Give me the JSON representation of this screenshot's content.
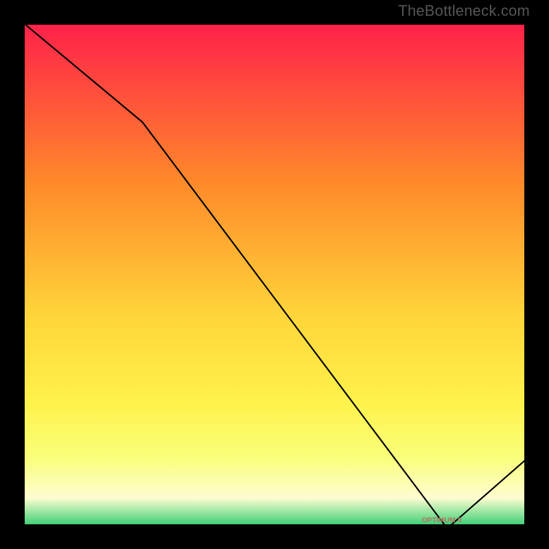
{
  "watermark": "TheBottleneck.com",
  "annotation_text": "OPTIMUM  0",
  "colors": {
    "top": "#ff1f4a",
    "mid1": "#ff8a2a",
    "mid2": "#ffd53a",
    "mid3": "#fff24a",
    "near": "#f9ff7a",
    "ivory": "#fffdd0",
    "green": "#23c96a",
    "line": "#000000",
    "wm": "#555555"
  },
  "chart_data": {
    "type": "line",
    "title": "",
    "xlabel": "",
    "ylabel": "",
    "xlim": [
      0,
      100
    ],
    "ylim": [
      0,
      100
    ],
    "x": [
      0,
      24,
      84,
      100
    ],
    "values": [
      100,
      80,
      0,
      14
    ],
    "optimum_x": 84,
    "annotation": {
      "x": 79,
      "y": 1.5,
      "text_key": "annotation_text"
    }
  }
}
